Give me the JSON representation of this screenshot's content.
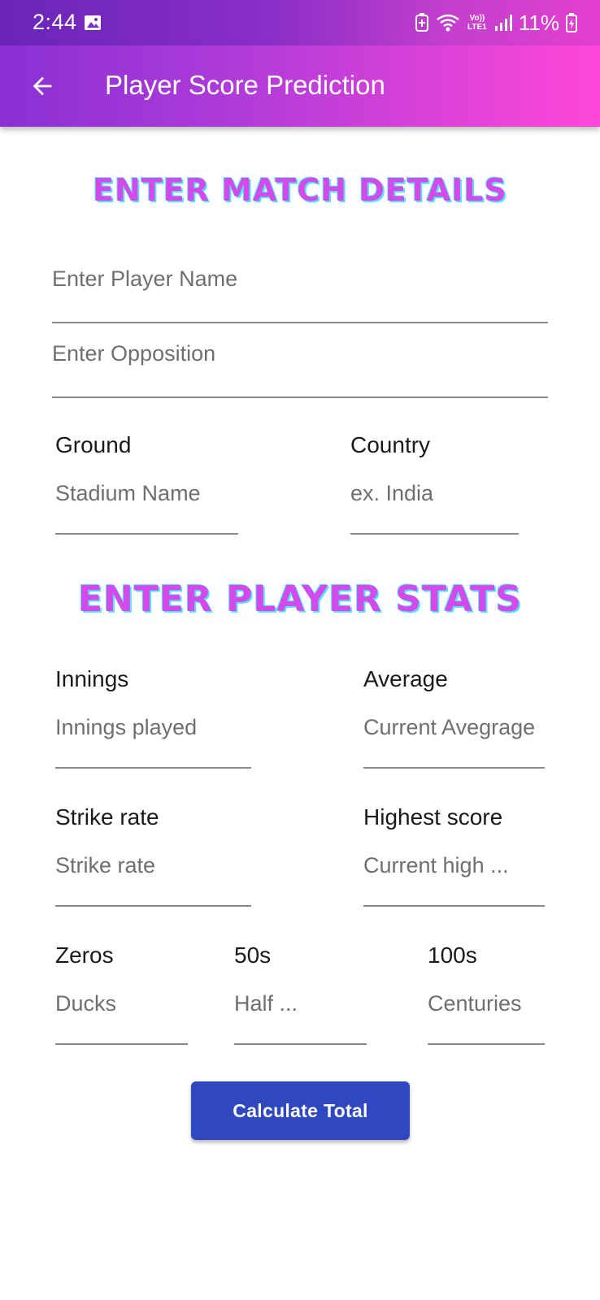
{
  "status_bar": {
    "time": "2:44",
    "battery": "11%",
    "network_label": "Vo)) LTE1",
    "icons": [
      "gallery-icon",
      "data-saver-icon",
      "wifi-icon",
      "volte-icon",
      "signal-icon",
      "battery-charging-icon"
    ]
  },
  "app_bar": {
    "title": "Player Score Prediction",
    "back_icon": "arrow-back-icon"
  },
  "match_section": {
    "heading": "Enter Match Details",
    "player_name_placeholder": "Enter Player Name",
    "opposition_placeholder": "Enter Opposition",
    "ground_label": "Ground",
    "ground_placeholder": "Stadium Name",
    "country_label": "Country",
    "country_placeholder": "ex. India"
  },
  "stats_section": {
    "heading": "Enter Player Stats",
    "innings_label": "Innings",
    "innings_placeholder": "Innings played",
    "average_label": "Average",
    "average_placeholder": "Current Avegrage",
    "strike_rate_label": "Strike rate",
    "strike_rate_placeholder": "Strike rate",
    "highest_label": "Highest score",
    "highest_placeholder": "Current high ...",
    "zeros_label": "Zeros",
    "zeros_placeholder": "Ducks",
    "fifties_label": "50s",
    "fifties_placeholder": "Half ...",
    "hundreds_label": "100s",
    "hundreds_placeholder": "Centuries"
  },
  "actions": {
    "calculate_label": "Calculate Total"
  },
  "colors": {
    "heading": "#d24bea",
    "heading_shadow": "#59e0f2",
    "button": "#2f47bf",
    "appbar_start": "#8a30d4",
    "appbar_end": "#ff47d8"
  }
}
